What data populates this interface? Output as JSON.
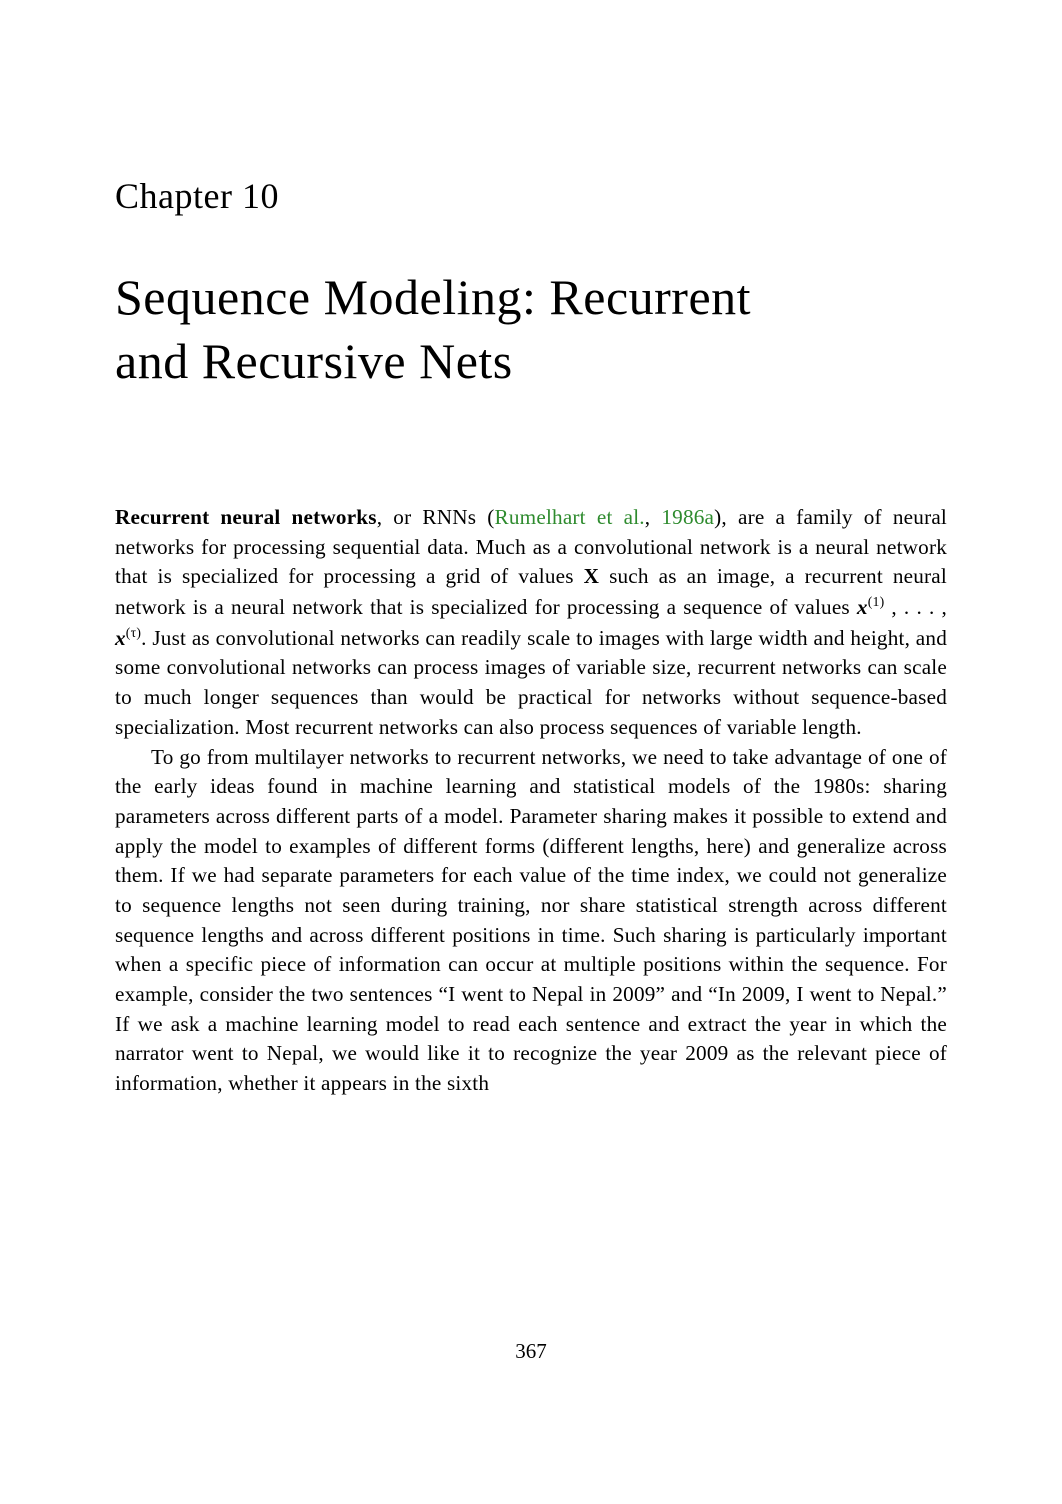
{
  "chapter_label": "Chapter 10",
  "chapter_title_line1": "Sequence Modeling: Recurrent",
  "chapter_title_line2": "and Recursive Nets",
  "para1": {
    "lead_bold": "Recurrent neural networks",
    "after_lead": ", or RNNs (",
    "cite_author": "Rumelhart et al.",
    "cite_sep": ", ",
    "cite_year": "1986a",
    "after_cite": "), are a family of neural networks for processing sequential data. Much as a convolutional network is a neural network that is specialized for processing a grid of values ",
    "grid_var": "X",
    "after_grid": " such as an image, a recurrent neural network is a neural network that is specialized for processing a sequence of values ",
    "seq_x1": "x",
    "seq_sup1": "(1)",
    "seq_mid": " , . . . , ",
    "seq_x2": "x",
    "seq_sup2": "(τ)",
    "after_seq": ". Just as convolutional networks can readily scale to images with large width and height, and some convolutional networks can process images of variable size, recurrent networks can scale to much longer sequences than would be practical for networks without sequence-based specialization. Most recurrent networks can also process sequences of variable length."
  },
  "para2": "To go from multilayer networks to recurrent networks, we need to take advantage of one of the early ideas found in machine learning and statistical models of the 1980s: sharing parameters across different parts of a model. Parameter sharing makes it possible to extend and apply the model to examples of different forms (different lengths, here) and generalize across them. If we had separate parameters for each value of the time index, we could not generalize to sequence lengths not seen during training, nor share statistical strength across different sequence lengths and across different positions in time. Such sharing is particularly important when a specific piece of information can occur at multiple positions within the sequence. For example, consider the two sentences “I went to Nepal in 2009” and “In 2009, I went to Nepal.” If we ask a machine learning model to read each sentence and extract the year in which the narrator went to Nepal, we would like it to recognize the year 2009 as the relevant piece of information, whether it appears in the sixth",
  "page_number": "367"
}
